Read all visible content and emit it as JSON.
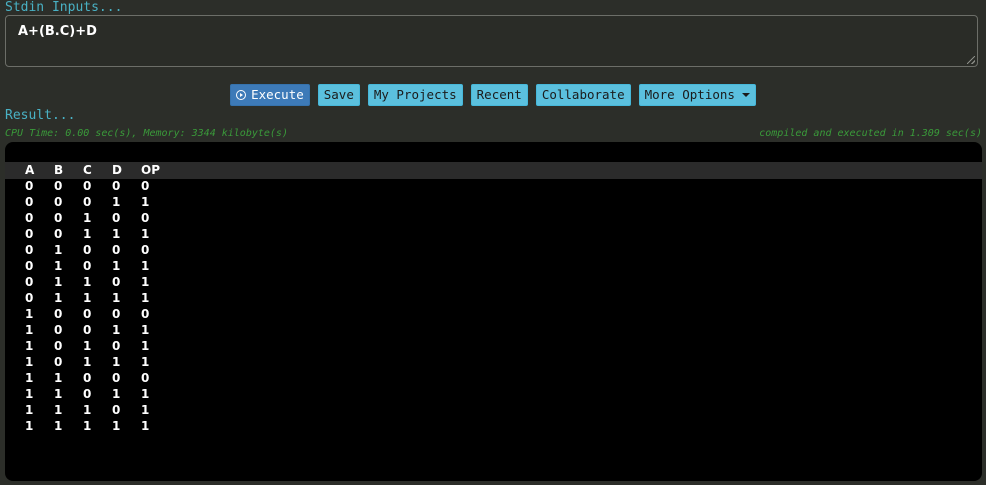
{
  "stdin": {
    "label": "Stdin Inputs...",
    "value": "A+(B.C)+D"
  },
  "toolbar": {
    "execute_label": "Execute",
    "save_label": "Save",
    "projects_label": "My Projects",
    "recent_label": "Recent",
    "collaborate_label": "Collaborate",
    "more_label": "More Options"
  },
  "result": {
    "label": "Result...",
    "stats_left": "CPU Time: 0.00 sec(s), Memory: 3344 kilobyte(s)",
    "stats_right": "compiled and executed in 1.309 sec(s)"
  },
  "output": {
    "headers": [
      "A",
      "B",
      "C",
      "D",
      "OP"
    ],
    "rows": [
      [
        "0",
        "0",
        "0",
        "0",
        "0"
      ],
      [
        "0",
        "0",
        "0",
        "1",
        "1"
      ],
      [
        "0",
        "0",
        "1",
        "0",
        "0"
      ],
      [
        "0",
        "0",
        "1",
        "1",
        "1"
      ],
      [
        "0",
        "1",
        "0",
        "0",
        "0"
      ],
      [
        "0",
        "1",
        "0",
        "1",
        "1"
      ],
      [
        "0",
        "1",
        "1",
        "0",
        "1"
      ],
      [
        "0",
        "1",
        "1",
        "1",
        "1"
      ],
      [
        "1",
        "0",
        "0",
        "0",
        "0"
      ],
      [
        "1",
        "0",
        "0",
        "1",
        "1"
      ],
      [
        "1",
        "0",
        "1",
        "0",
        "1"
      ],
      [
        "1",
        "0",
        "1",
        "1",
        "1"
      ],
      [
        "1",
        "1",
        "0",
        "0",
        "0"
      ],
      [
        "1",
        "1",
        "0",
        "1",
        "1"
      ],
      [
        "1",
        "1",
        "1",
        "0",
        "1"
      ],
      [
        "1",
        "1",
        "1",
        "1",
        "1"
      ]
    ]
  },
  "colors": {
    "background": "#2c2e29",
    "label": "#49b1c4",
    "stats": "#3a9a3a",
    "button": "#5bc0de",
    "button_primary": "#3d7ab8",
    "output_bg": "#000000"
  }
}
